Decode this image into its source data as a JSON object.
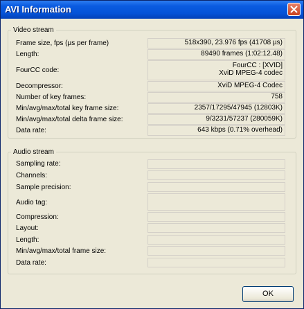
{
  "window": {
    "title": "AVI Information"
  },
  "video": {
    "legend": "Video stream",
    "rows": [
      {
        "label": "Frame size, fps (µs per frame)",
        "value": "518x390, 23.976 fps (41708 µs)"
      },
      {
        "label": "Length:",
        "value": "89490 frames (1:02:12.48)"
      },
      {
        "label": "FourCC code:",
        "value": "FourCC : [XVID]",
        "value2": "XviD MPEG-4 codec"
      },
      {
        "label": "Decompressor:",
        "value": "XviD MPEG-4 Codec"
      },
      {
        "label": "Number of key frames:",
        "value": "758"
      },
      {
        "label": "Min/avg/max/total key frame size:",
        "value": "2357/17295/47945 (12803K)"
      },
      {
        "label": "Min/avg/max/total delta frame size:",
        "value": "9/3231/57237 (280059K)"
      },
      {
        "label": "Data rate:",
        "value": "643 kbps (0.71% overhead)"
      }
    ]
  },
  "audio": {
    "legend": "Audio stream",
    "rows": [
      {
        "label": "Sampling rate:",
        "value": ""
      },
      {
        "label": "Channels:",
        "value": ""
      },
      {
        "label": "Sample precision:",
        "value": ""
      },
      {
        "label": "Audio tag:",
        "value": ""
      },
      {
        "label": "Compression:",
        "value": ""
      },
      {
        "label": "Layout:",
        "value": ""
      },
      {
        "label": "Length:",
        "value": ""
      },
      {
        "label": "Min/avg/max/total frame size:",
        "value": ""
      },
      {
        "label": "Data rate:",
        "value": ""
      }
    ]
  },
  "buttons": {
    "ok": "OK"
  }
}
